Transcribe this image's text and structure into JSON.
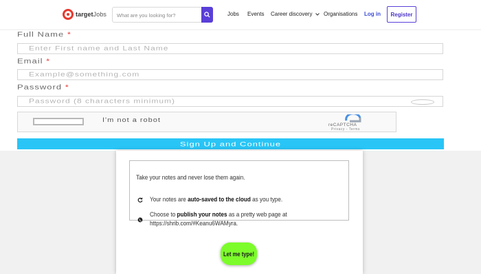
{
  "header": {
    "logo": {
      "brand": "target",
      "suffix": "Jobs"
    },
    "search": {
      "placeholder": "What are you looking for?"
    },
    "nav": {
      "jobs": "Jobs",
      "events": "Events",
      "career": "Career discovery",
      "orgs": "Organisations"
    },
    "login": "Log in",
    "register": "Register",
    "colors": {
      "accent": "#5a3fd8",
      "logo": "#e63a2e"
    }
  },
  "form": {
    "full_name": {
      "label": "Full Name",
      "required": "*",
      "placeholder": "Enter First name and Last Name"
    },
    "email": {
      "label": "Email",
      "required": "*",
      "placeholder": "Example@something.com"
    },
    "password": {
      "label": "Password",
      "required": "*",
      "placeholder": "Password (8 characters minimum)"
    },
    "captcha": {
      "label": "I'm not a robot",
      "brand": "reCAPTCHA",
      "links": "Privacy - Terms"
    },
    "submit": "Sign Up and Continue",
    "colors": {
      "submit_bg": "#29c5f6",
      "required": "#e53935"
    }
  },
  "notes": {
    "intro": "Take your notes and never lose them again.",
    "features": [
      {
        "icon": "refresh-icon",
        "pre": "Your notes are ",
        "bold": "auto-saved to the cloud",
        "post": " as you type."
      },
      {
        "icon": "globe-icon",
        "pre": "Choose to ",
        "bold": "publish your notes",
        "post": " as a pretty web page at",
        "line2": "https://shrib.com/#Keanu6WAMyra."
      }
    ],
    "cta": "Let me type!",
    "colors": {
      "cta_bg": "#7cfc2a"
    }
  }
}
